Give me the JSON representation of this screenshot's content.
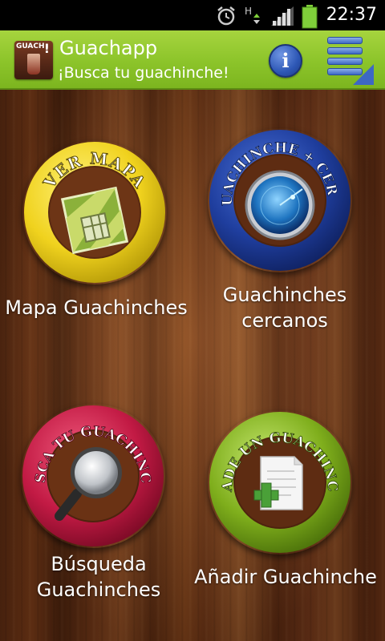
{
  "status_bar": {
    "time": "22:37",
    "icons": [
      "alarm-icon",
      "hspa-data-icon",
      "signal-icon",
      "battery-icon"
    ]
  },
  "header": {
    "title": "Guachapp",
    "subtitle": "¡Busca tu guachinche!",
    "logo_text": "GUACH",
    "logo_mark": "!",
    "info_label": "i",
    "menu_icon": "menu-icon"
  },
  "tiles": [
    {
      "badge_text": "VER MAPA",
      "label": "Mapa Guachinches",
      "ring_color": "#f0d21e",
      "icon": "map-icon"
    },
    {
      "badge_text": "GUACHINCHE + CERCA",
      "label": "Guachinches cercanos",
      "ring_color": "#1f3e9e",
      "icon": "radar-icon"
    },
    {
      "badge_text": "BUSCA TU GUACHINCHE",
      "label": "Búsqueda Guachinches",
      "ring_color": "#c21a44",
      "icon": "magnifier-icon"
    },
    {
      "badge_text": "AÑADE UN GUACHINCHE",
      "label": "Añadir Guachinche",
      "ring_color": "#7fae1c",
      "icon": "add-document-icon"
    }
  ],
  "colors": {
    "header_green": "#8cc42a",
    "wood_brown": "#6d3516"
  }
}
